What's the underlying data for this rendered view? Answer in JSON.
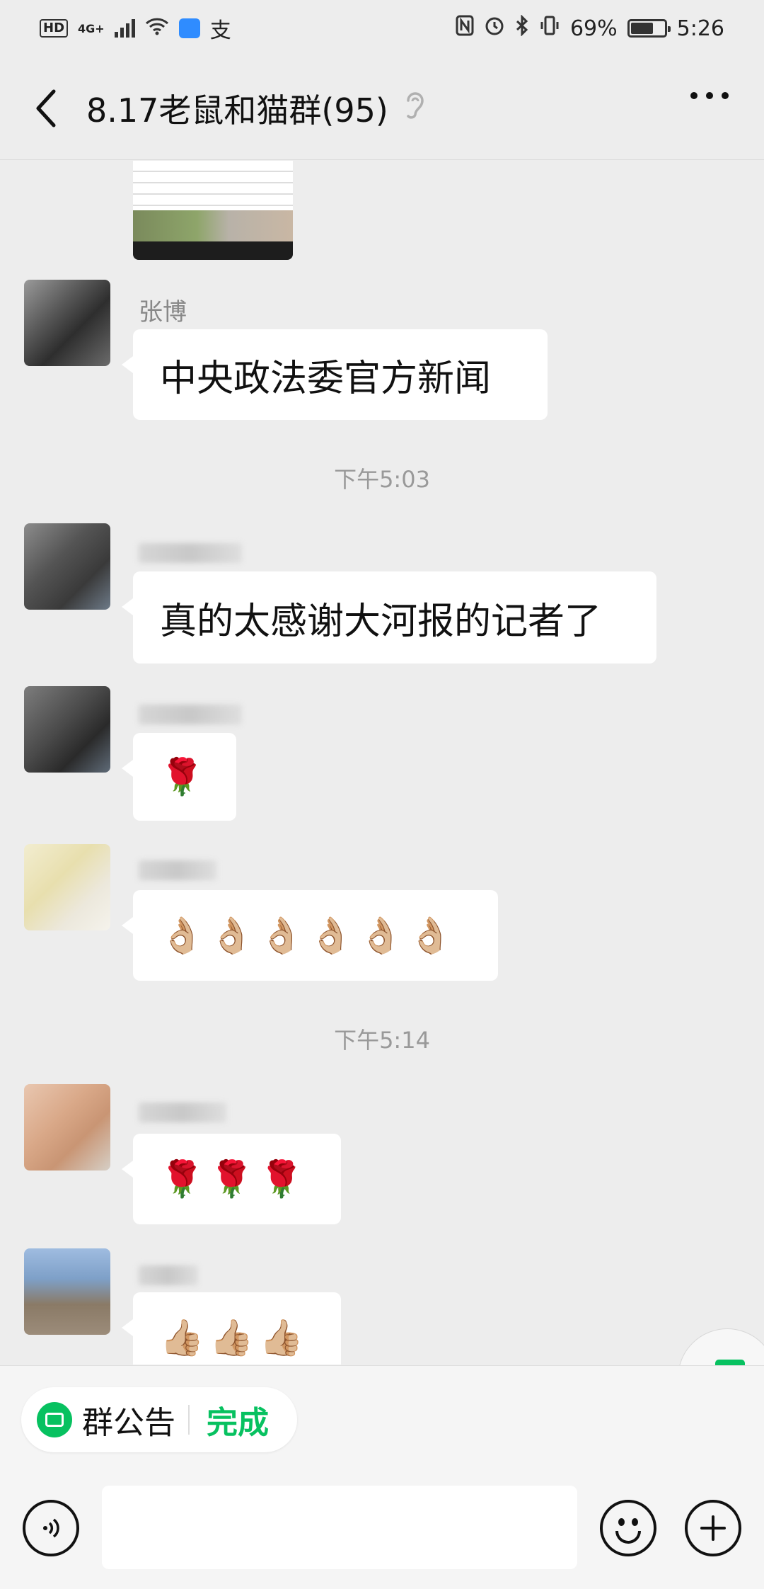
{
  "status_bar": {
    "hd": "HD",
    "signal_type": "4G+",
    "payment_icon": "支",
    "battery_percent": "69%",
    "time": "5:26",
    "battery_level": 0.69
  },
  "header": {
    "title": "8.17老鼠和猫群(95)"
  },
  "messages": {
    "m1": {
      "sender": "张博",
      "text": "中央政法委官方新闻"
    },
    "ts1": "下午5:03",
    "m2": {
      "text": "真的太感谢大河报的记者了"
    },
    "m3": {
      "text": "🌹"
    },
    "m4": {
      "text": "👌🏼👌🏼👌🏼👌🏼👌🏼👌🏼"
    },
    "ts2": "下午5:14",
    "m5": {
      "text": "🌹🌹🌹"
    },
    "m6": {
      "text": "👍🏼👍🏼👍🏼"
    }
  },
  "announcement": {
    "label": "群公告",
    "done": "完成"
  },
  "input": {
    "placeholder": ""
  },
  "colors": {
    "accent": "#07c160",
    "background": "#ededed",
    "bubble": "#ffffff"
  },
  "icons": [
    "back-icon",
    "ear-icon",
    "more-icon",
    "notes-icon",
    "announcement-icon",
    "voice-icon",
    "emoji-icon",
    "plus-icon"
  ]
}
